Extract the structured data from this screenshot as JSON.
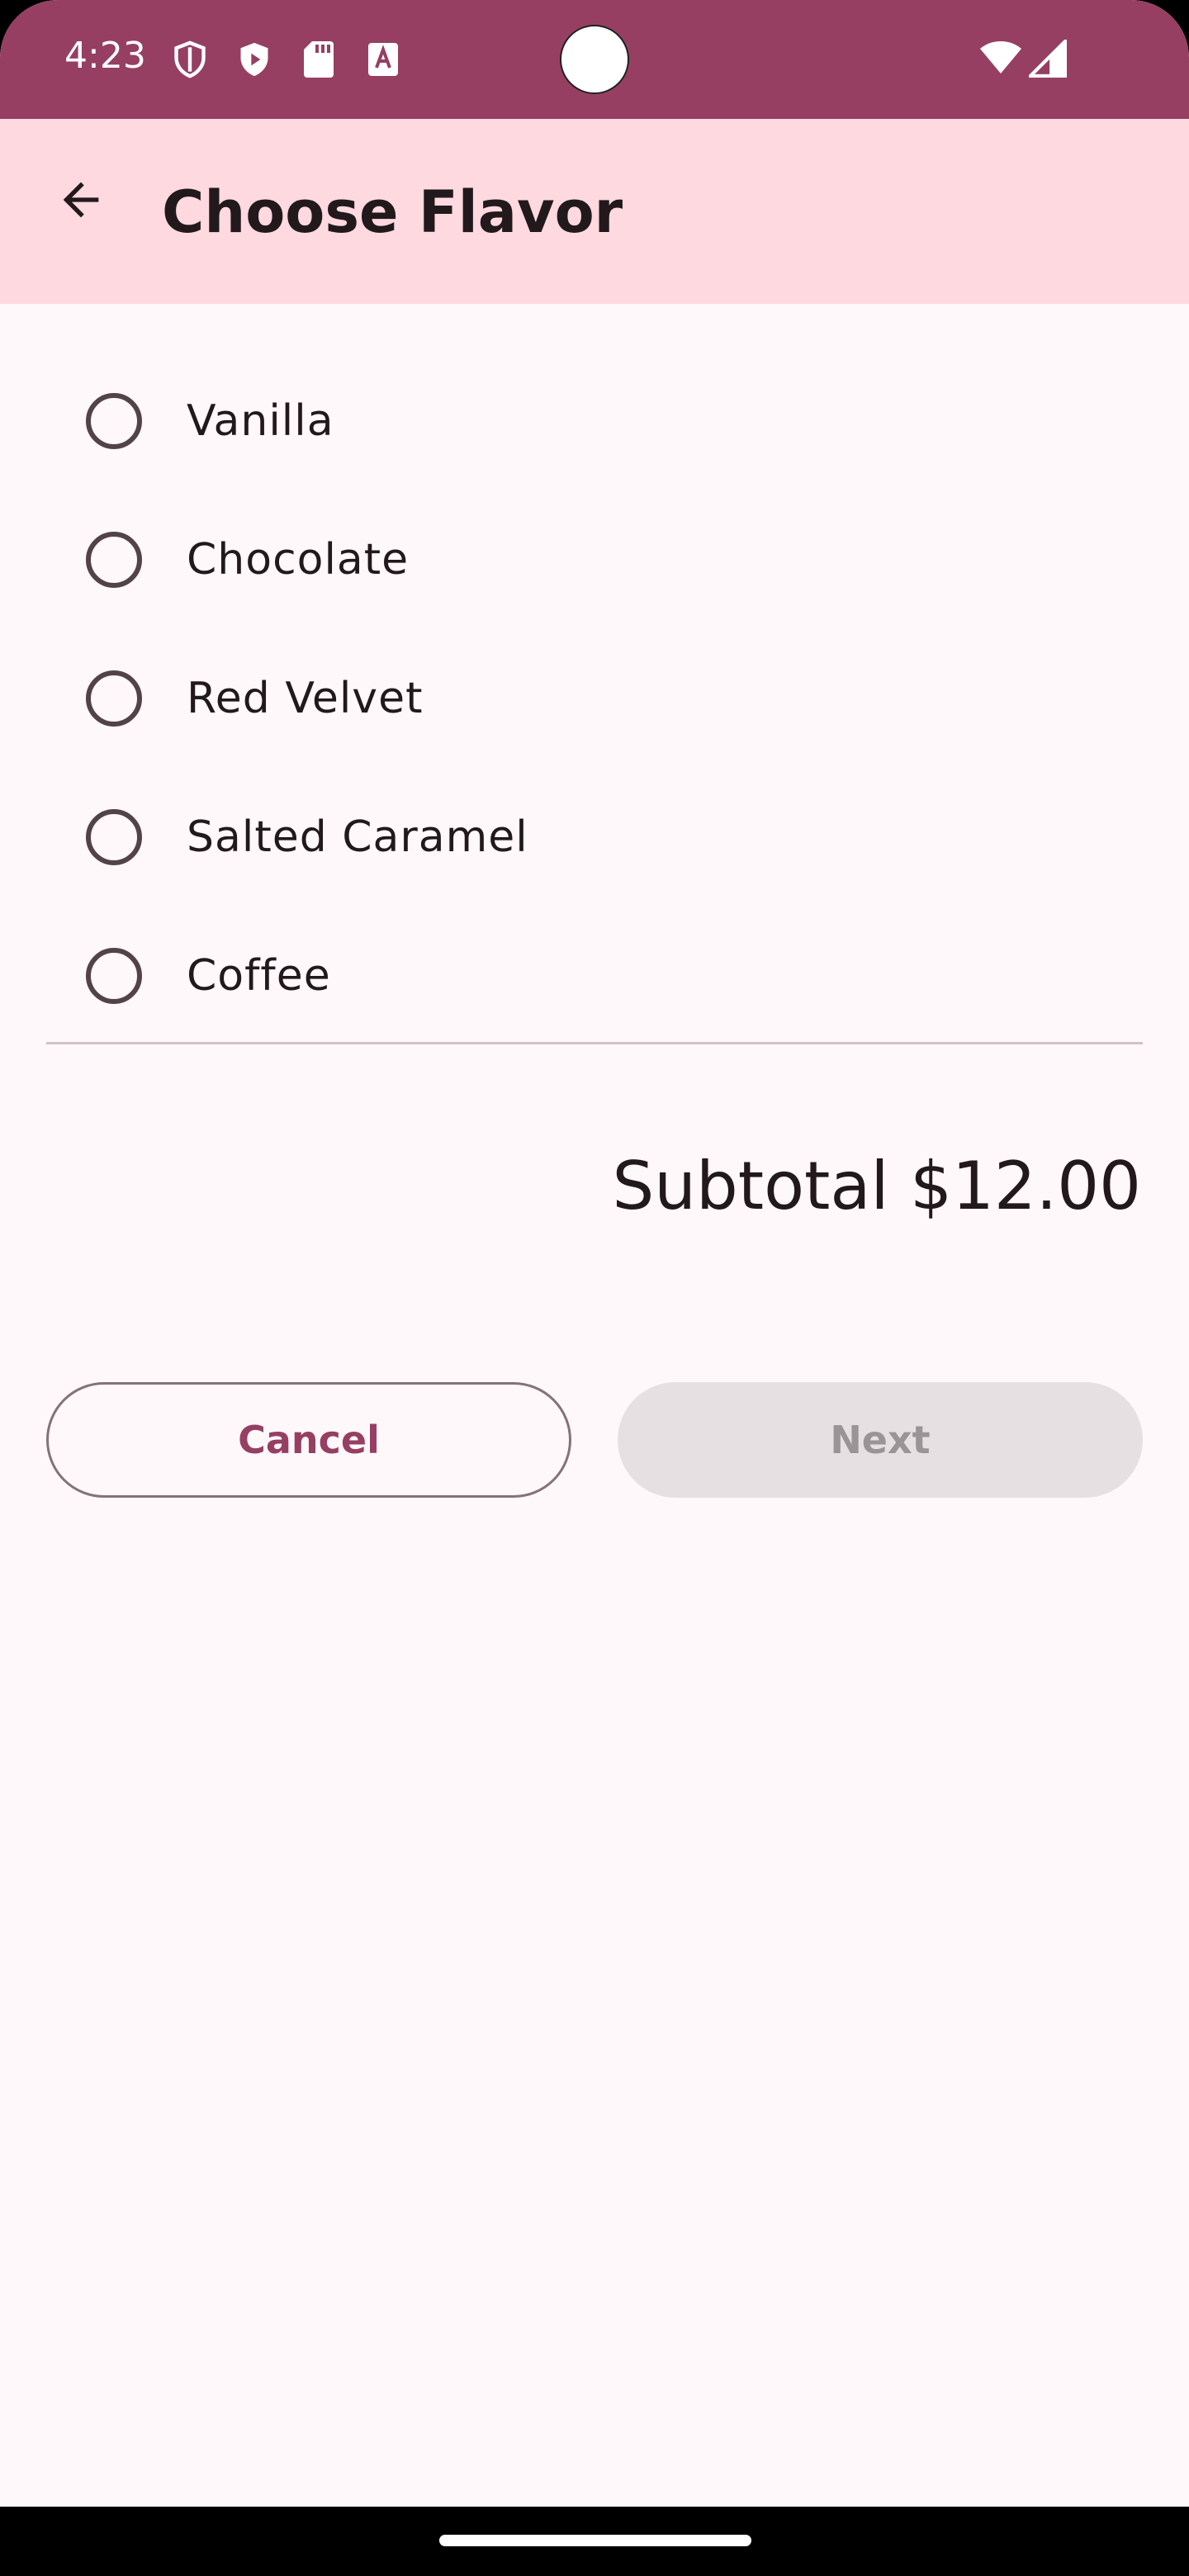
{
  "status_bar": {
    "time": "4:23",
    "icons": [
      "shield-outline-icon",
      "play-shield-icon",
      "sd-card-icon",
      "font-a-icon",
      "wifi-icon",
      "signal-icon"
    ],
    "color": "#963f63"
  },
  "app_bar": {
    "title": "Choose Flavor",
    "back_icon": "arrow-back-icon",
    "color": "#ffd9e0"
  },
  "flavors": [
    {
      "label": "Vanilla",
      "selected": false
    },
    {
      "label": "Chocolate",
      "selected": false
    },
    {
      "label": "Red Velvet",
      "selected": false
    },
    {
      "label": "Salted Caramel",
      "selected": false
    },
    {
      "label": "Coffee",
      "selected": false
    }
  ],
  "summary": {
    "subtotal": "Subtotal $12.00"
  },
  "actions": {
    "cancel_label": "Cancel",
    "next_label": "Next",
    "next_enabled": false
  },
  "colors": {
    "accent": "#963f63",
    "background": "#fff8fb"
  }
}
